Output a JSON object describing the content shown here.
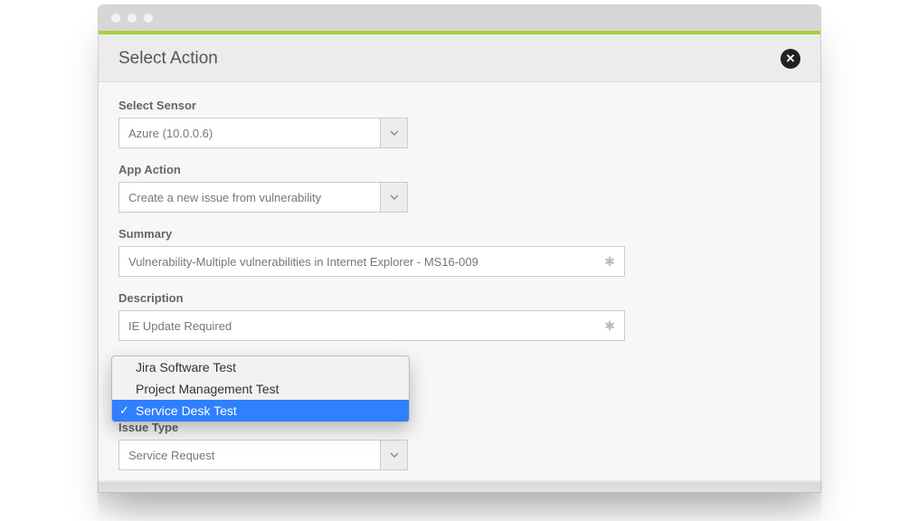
{
  "header": {
    "title": "Select Action"
  },
  "fields": {
    "sensor": {
      "label": "Select Sensor",
      "value": "Azure (10.0.0.6)"
    },
    "app_action": {
      "label": "App Action",
      "value": "Create a new issue from vulnerability"
    },
    "summary": {
      "label": "Summary",
      "value": "Vulnerability-Multiple vulnerabilities in Internet Explorer - MS16-009"
    },
    "description": {
      "label": "Description",
      "value": "IE Update Required"
    },
    "project": {
      "options": [
        "Jira Software Test",
        "Project Management Test",
        "Service Desk Test"
      ],
      "selected": "Service Desk Test"
    },
    "issue_type": {
      "label": "Issue Type",
      "value": "Service Request"
    }
  }
}
